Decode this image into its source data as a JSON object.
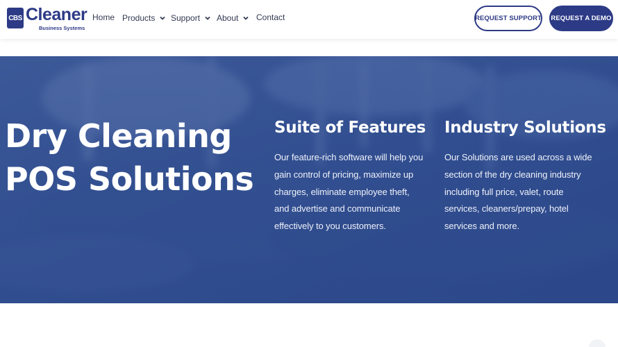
{
  "header": {
    "logo": {
      "mark": "CBS",
      "name": "Cleaner",
      "subtitle": "Business Systems"
    },
    "nav": [
      {
        "label": "Home"
      },
      {
        "label": "Products"
      },
      {
        "label": "Support"
      },
      {
        "label": "About"
      },
      {
        "label": "Contact"
      }
    ],
    "buttons": {
      "support": "REQUEST SUPPORT",
      "demo": "REQUEST A DEMO"
    }
  },
  "hero": {
    "title": "Dry Cleaning POS Solutions",
    "features": {
      "title": "Suite of Features",
      "body": "Our feature-rich software will help you gain control of pricing, maximize up charges, eliminate employee theft, and advertise and communicate effectively to you customers."
    },
    "industry": {
      "title": "Industry Solutions",
      "body": "Our Solutions are used across a wide section of the dry cleaning industry including full price, valet, route services, cleaners/prepay, hotel services and more."
    }
  },
  "colors": {
    "brand": "#2d3a86",
    "hero_overlay": "#2c4a8e",
    "nav_text": "#333a52"
  }
}
